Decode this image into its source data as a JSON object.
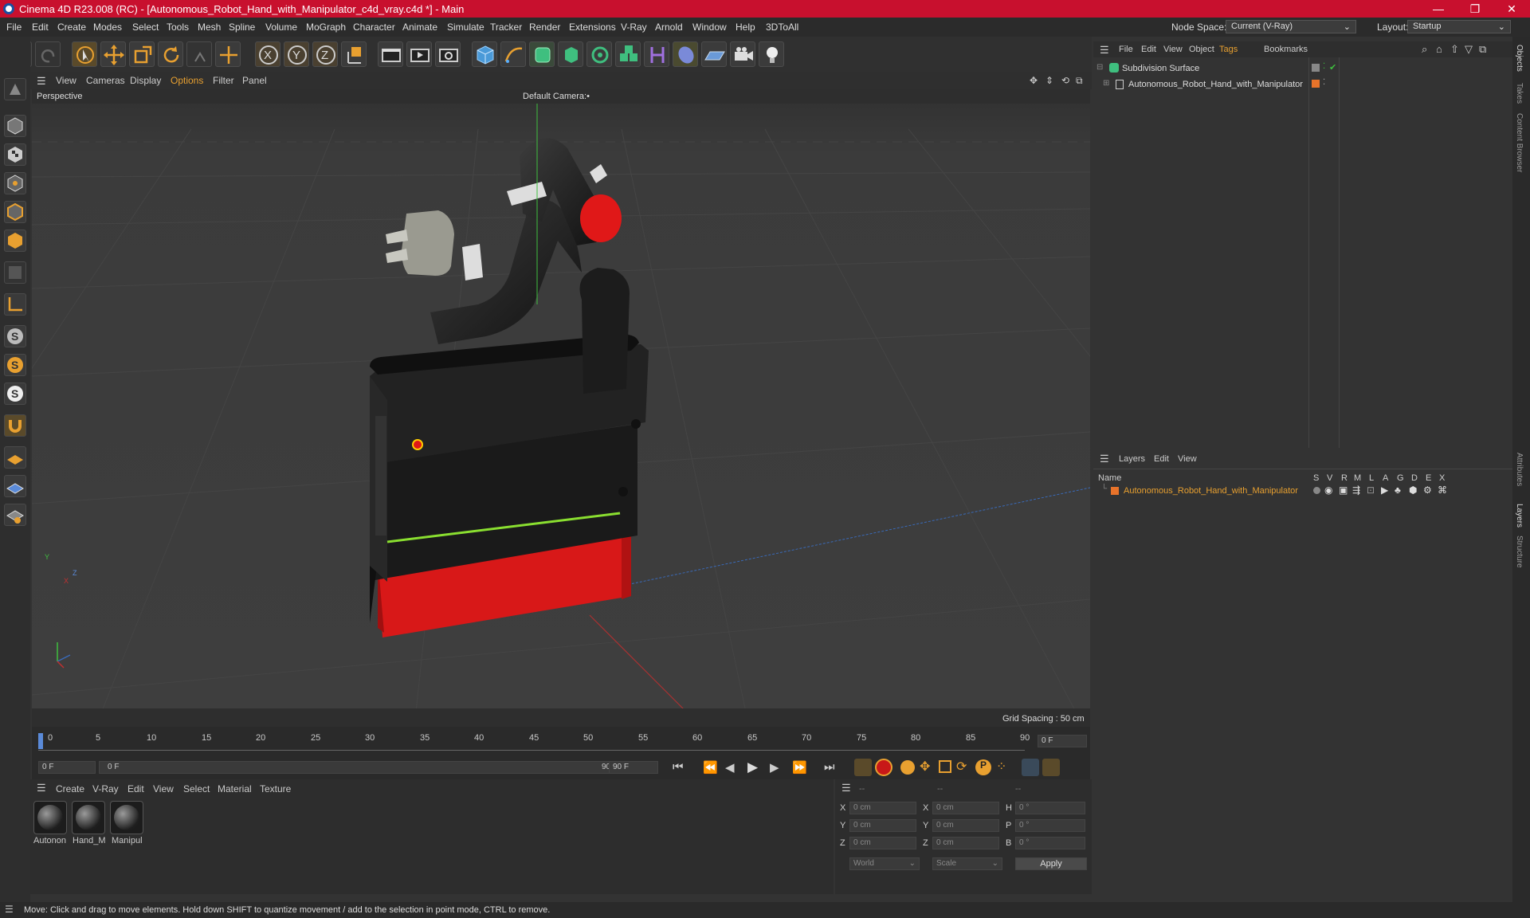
{
  "window": {
    "title": "Cinema 4D R23.008 (RC) - [Autonomous_Robot_Hand_with_Manipulator_c4d_vray.c4d *] - Main",
    "minimize": "—",
    "restore": "❐",
    "close": "✕"
  },
  "menubar": {
    "items": [
      "File",
      "Edit",
      "Create",
      "Modes",
      "Select",
      "Tools",
      "Mesh",
      "Spline",
      "Volume",
      "MoGraph",
      "Character",
      "Animate",
      "Simulate",
      "Tracker",
      "Render",
      "Extensions",
      "V-Ray",
      "Arnold",
      "Window",
      "Help",
      "3DToAll"
    ],
    "node_space_label": "Node Space:",
    "node_space_value": "Current (V-Ray)",
    "layout_label": "Layout:",
    "layout_value": "Startup"
  },
  "viewport_menu": {
    "items": [
      "View",
      "Cameras",
      "Display",
      "Options",
      "Filter",
      "Panel"
    ]
  },
  "viewport": {
    "name": "Perspective",
    "camera": "Default Camera",
    "camera_suffix": ":•",
    "grid_spacing": "Grid Spacing : 50 cm",
    "axis_y": "Y",
    "axis_z": "Z",
    "axis_x": "X"
  },
  "timeline": {
    "ticks": [
      "0",
      "5",
      "10",
      "15",
      "20",
      "25",
      "30",
      "35",
      "40",
      "45",
      "50",
      "55",
      "60",
      "65",
      "70",
      "75",
      "80",
      "85",
      "90"
    ],
    "current_frame": "0 F",
    "start_field": "0 F",
    "range_start": "0 F",
    "range_end": "90 F",
    "end_field": "90 F"
  },
  "material_menu": {
    "items": [
      "Create",
      "V-Ray",
      "Edit",
      "View",
      "Select",
      "Material",
      "Texture"
    ]
  },
  "materials": [
    {
      "label": "Autonon"
    },
    {
      "label": "Hand_M"
    },
    {
      "label": "Manipul"
    }
  ],
  "coords": {
    "header": [
      "--",
      "--",
      "--"
    ],
    "rows": [
      {
        "a": "X",
        "av": "0 cm",
        "b": "X",
        "bv": "0 cm",
        "c": "H",
        "cv": "0 °"
      },
      {
        "a": "Y",
        "av": "0 cm",
        "b": "Y",
        "bv": "0 cm",
        "c": "P",
        "cv": "0 °"
      },
      {
        "a": "Z",
        "av": "0 cm",
        "b": "Z",
        "bv": "0 cm",
        "c": "B",
        "cv": "0 °"
      }
    ],
    "world": "World",
    "scale": "Scale",
    "apply": "Apply"
  },
  "object_manager": {
    "menu": [
      "File",
      "Edit",
      "View",
      "Object",
      "Tags",
      "Bookmarks"
    ],
    "items": [
      {
        "name": "Subdivision Surface"
      },
      {
        "name": "Autonomous_Robot_Hand_with_Manipulator"
      }
    ]
  },
  "layer_manager": {
    "menu": [
      "Layers",
      "Edit",
      "View"
    ],
    "columns": [
      "Name",
      "S",
      "V",
      "R",
      "M",
      "L",
      "A",
      "G",
      "D",
      "E",
      "X"
    ],
    "layers": [
      {
        "name": "Autonomous_Robot_Hand_with_Manipulator",
        "color": "#e8732a"
      }
    ]
  },
  "right_tabs": [
    "Objects",
    "Takes",
    "Content Browser",
    "Attributes",
    "Layers",
    "Structure"
  ],
  "status": {
    "text": "Move: Click and drag to move elements. Hold down SHIFT to quantize movement / add to the selection in point mode, CTRL to remove."
  },
  "colors": {
    "titlebar": "#c8102e",
    "accent_orange": "#e8a030",
    "robot_red": "#e01818",
    "accent_green": "#8adf30"
  }
}
